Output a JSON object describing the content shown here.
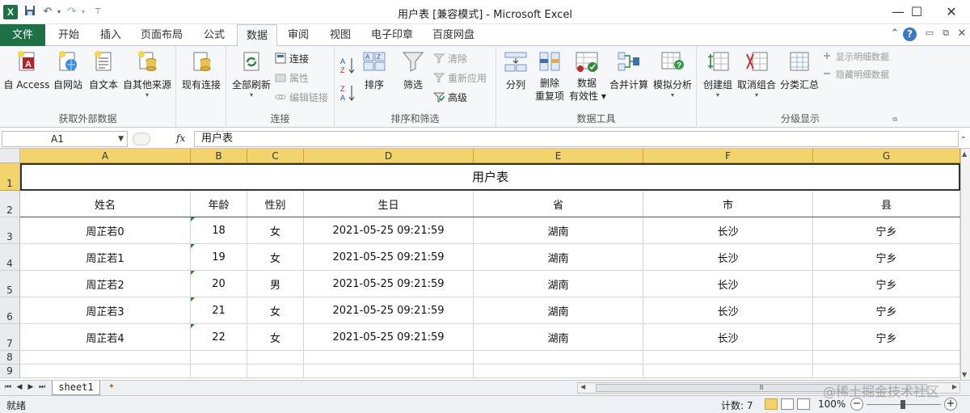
{
  "window": {
    "title": "用户表  [兼容模式]  -  Microsoft Excel",
    "controls": [
      "minimize-icon",
      "maximize-icon",
      "close-icon"
    ]
  },
  "quick_access": [
    "save-icon",
    "undo-icon",
    "redo-icon",
    "customize-icon"
  ],
  "tabs": {
    "file": "文件",
    "items": [
      "开始",
      "插入",
      "页面布局",
      "公式",
      "数据",
      "审阅",
      "视图",
      "电子印章",
      "百度网盘"
    ],
    "active": "数据"
  },
  "ribbon": {
    "groups": {
      "external_data": {
        "label": "获取外部数据",
        "access": "自 Access",
        "web": "自网站",
        "text": "自文本",
        "other": "自其他来源"
      },
      "existing": {
        "label": "现有连接"
      },
      "connections": {
        "label": "连接",
        "refresh_all": "全部刷新",
        "connections": "连接",
        "properties": "属性",
        "edit_links": "编辑链接"
      },
      "sort_filter": {
        "label": "排序和筛选",
        "sort": "排序",
        "filter": "筛选",
        "clear": "清除",
        "reapply": "重新应用",
        "advanced": "高级"
      },
      "data_tools": {
        "label": "数据工具",
        "text_to_columns": "分列",
        "remove_dup_1": "删除",
        "remove_dup_2": "重复项",
        "validation_1": "数据",
        "validation_2": "有效性",
        "consolidate": "合并计算",
        "what_if": "模拟分析"
      },
      "outline": {
        "label": "分级显示",
        "group": "创建组",
        "ungroup": "取消组合",
        "subtotal": "分类汇总",
        "show_detail": "显示明细数据",
        "hide_detail": "隐藏明细数据"
      }
    }
  },
  "formula_bar": {
    "name_box": "A1",
    "fx": "fx",
    "content": "用户表"
  },
  "sheet": {
    "columns": [
      "A",
      "B",
      "C",
      "D",
      "E",
      "F",
      "G"
    ],
    "rows": [
      "1",
      "2",
      "3",
      "4",
      "5",
      "6",
      "7",
      "8",
      "9"
    ],
    "title": "用户表",
    "headers": [
      "姓名",
      "年龄",
      "性别",
      "生日",
      "省",
      "市",
      "县"
    ],
    "data": [
      [
        "周芷若0",
        "18",
        "女",
        "2021-05-25 09:21:59",
        "湖南",
        "长沙",
        "宁乡"
      ],
      [
        "周芷若1",
        "19",
        "女",
        "2021-05-25 09:21:59",
        "湖南",
        "长沙",
        "宁乡"
      ],
      [
        "周芷若2",
        "20",
        "男",
        "2021-05-25 09:21:59",
        "湖南",
        "长沙",
        "宁乡"
      ],
      [
        "周芷若3",
        "21",
        "女",
        "2021-05-25 09:21:59",
        "湖南",
        "长沙",
        "宁乡"
      ],
      [
        "周芷若4",
        "22",
        "女",
        "2021-05-25 09:21:59",
        "湖南",
        "长沙",
        "宁乡"
      ]
    ]
  },
  "sheet_tabs": [
    "sheet1"
  ],
  "status": {
    "ready": "就绪",
    "count": "计数: 7",
    "zoom": "100%"
  },
  "watermark": "@稀土掘金技术社区"
}
